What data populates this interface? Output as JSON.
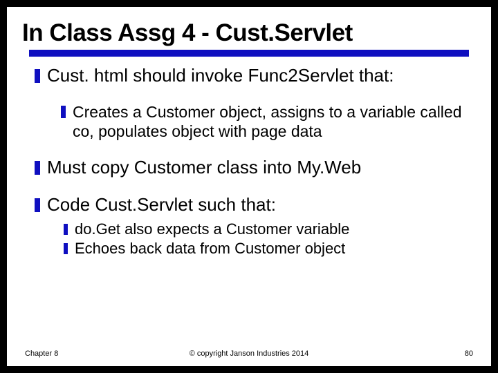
{
  "title": "In Class Assg 4 - Cust.Servlet",
  "bullets": {
    "b1": "Cust. html should invoke Func2Servlet that:",
    "b1_1": "Creates a Customer object, assigns to a variable called co, populates object with page data",
    "b2": "Must copy Customer class into My.Web",
    "b3": "Code Cust.Servlet such that:",
    "b3_1": "do.Get also expects a Customer variable",
    "b3_2": "Echoes back data from Customer object"
  },
  "footer": {
    "left": "Chapter 8",
    "center": "© copyright Janson Industries 2014",
    "right": "80"
  }
}
